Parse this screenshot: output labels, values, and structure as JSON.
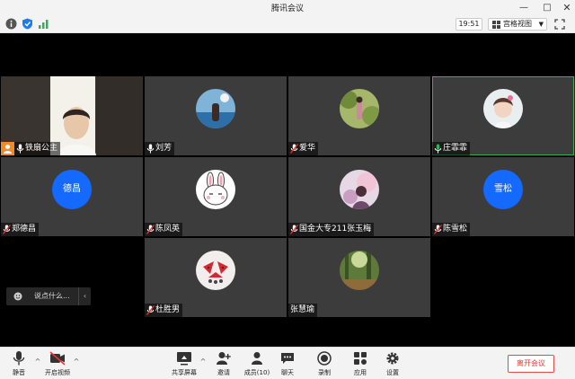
{
  "window": {
    "title": "腾讯会议"
  },
  "topbar": {
    "time": "19:51",
    "view_mode": "宫格视图"
  },
  "participants": [
    {
      "name": "铁扇公主",
      "kind": "video",
      "avatar": "video-person"
    },
    {
      "name": "刘芳",
      "kind": "avatar",
      "avatar": "photo-seaside"
    },
    {
      "name": "爱华",
      "kind": "avatar",
      "avatar": "photo-garden"
    },
    {
      "name": "庄霏霏",
      "kind": "avatar",
      "avatar": "photo-child",
      "active": true
    },
    {
      "name": "郑德昌",
      "kind": "initials",
      "initials": "德昌"
    },
    {
      "name": "陈凤英",
      "kind": "avatar",
      "avatar": "photo-bunny"
    },
    {
      "name": "国金大专211张玉梅",
      "kind": "avatar",
      "avatar": "photo-flowers"
    },
    {
      "name": "陈雪松",
      "kind": "initials",
      "initials": "雪松"
    },
    {
      "name": "杜胜男",
      "kind": "avatar",
      "avatar": "photo-watermelon"
    },
    {
      "name": "张慧瑜",
      "kind": "avatar",
      "avatar": "photo-forest"
    }
  ],
  "chat": {
    "placeholder": "说点什么..."
  },
  "toolbar": {
    "mute": "静音",
    "video": "开启视频",
    "share": "共享屏幕",
    "invite": "邀请",
    "members": "成员(10)",
    "chat": "聊天",
    "record": "录制",
    "apps": "应用",
    "settings": "设置",
    "leave": "离开会议"
  },
  "colors": {
    "accent": "#1469ff",
    "active_border": "#2fb05a",
    "danger": "#e33333"
  }
}
